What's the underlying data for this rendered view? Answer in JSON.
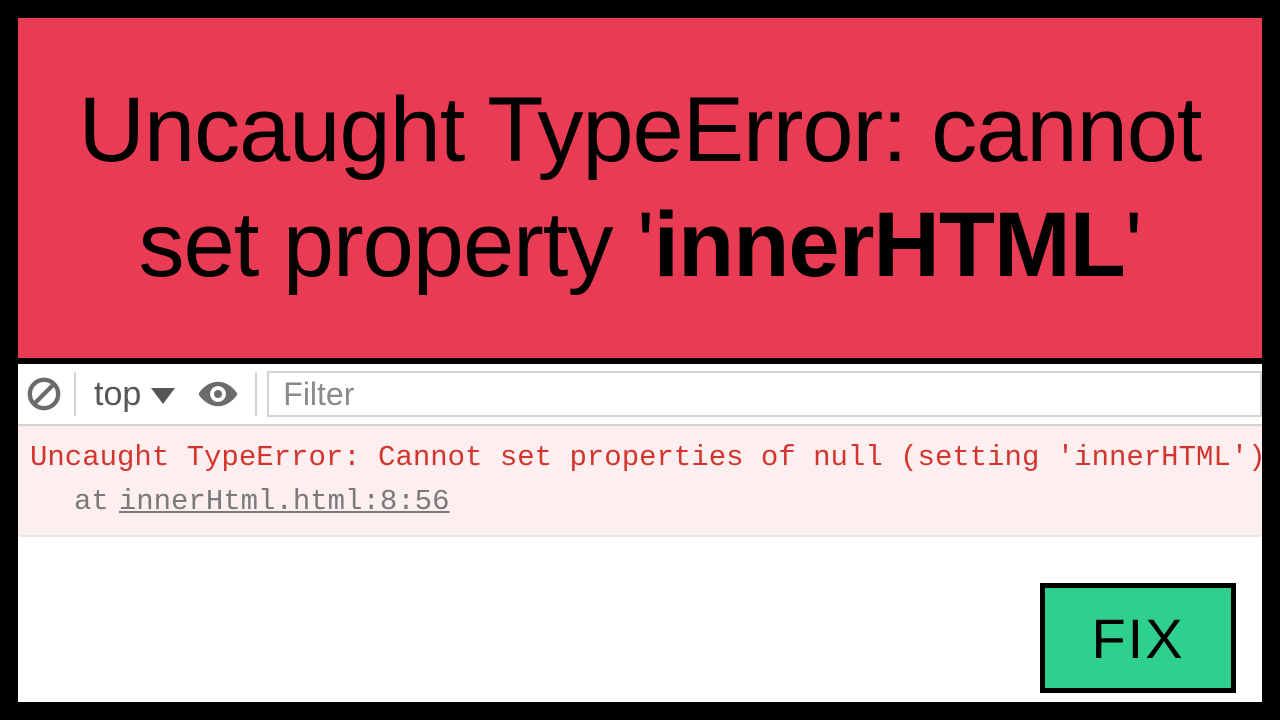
{
  "banner": {
    "line1": "Uncaught TypeError: cannot",
    "line2_prefix": "set property '",
    "line2_bold": "innerHTML",
    "line2_suffix": "'"
  },
  "toolbar": {
    "context_label": "top",
    "filter_placeholder": "Filter"
  },
  "error": {
    "message": "Uncaught TypeError: Cannot set properties of null (setting 'innerHTML')",
    "at_label": "at",
    "location": "innerHtml.html:8:56"
  },
  "fix_label": "FIX",
  "colors": {
    "banner_bg": "#ea3b55",
    "error_text": "#d3362f",
    "error_bg": "#fdefef",
    "fix_bg": "#2fcf8d"
  }
}
